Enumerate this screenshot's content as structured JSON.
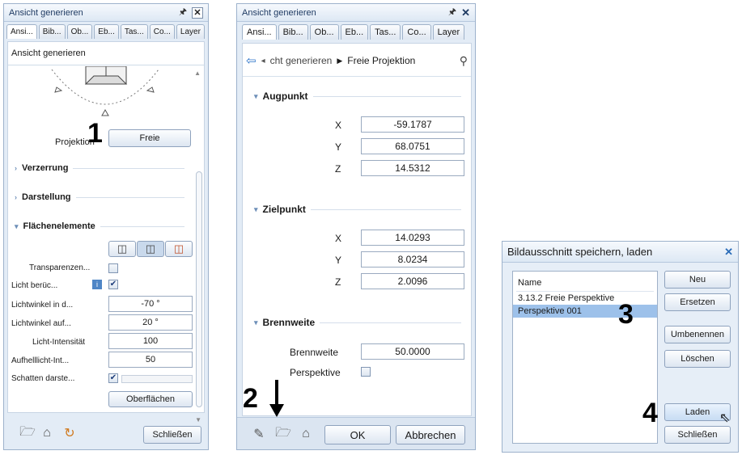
{
  "panel1": {
    "title": "Ansicht generieren",
    "tabs": [
      "Ansi...",
      "Bib...",
      "Ob...",
      "Eb...",
      "Tas...",
      "Co...",
      "Layer"
    ],
    "subtitle": "Ansicht generieren",
    "projektion_label": "Projektion",
    "projektion_value": "Freie",
    "sections": [
      "Verzerrung",
      "Darstellung",
      "Flächenelemente"
    ],
    "rows": [
      {
        "label": "Transparenzen...",
        "value": ""
      },
      {
        "label": "Licht berüc...",
        "value": ""
      },
      {
        "label": "Lichtwinkel in d...",
        "value": "-70 °"
      },
      {
        "label": "Lichtwinkel auf...",
        "value": "20 °"
      },
      {
        "label": "Licht-Intensität",
        "value": "100"
      },
      {
        "label": "Aufhelllicht-Int...",
        "value": "50"
      },
      {
        "label": "Schatten darste...",
        "value": ""
      }
    ],
    "oberflaechen": "Oberflächen",
    "close": "Schließen"
  },
  "panel2": {
    "title": "Ansicht generieren",
    "tabs": [
      "Ansi...",
      "Bib...",
      "Ob...",
      "Eb...",
      "Tas...",
      "Co...",
      "Layer"
    ],
    "breadcrumb_1": "cht generieren",
    "breadcrumb_2": "Freie Projektion",
    "augpunkt_header": "Augpunkt",
    "augpunkt": [
      {
        "axis": "X",
        "value": "-59.1787"
      },
      {
        "axis": "Y",
        "value": "68.0751"
      },
      {
        "axis": "Z",
        "value": "14.5312"
      }
    ],
    "zielpunkt_header": "Zielpunkt",
    "zielpunkt": [
      {
        "axis": "X",
        "value": "14.0293"
      },
      {
        "axis": "Y",
        "value": "8.0234"
      },
      {
        "axis": "Z",
        "value": "2.0096"
      }
    ],
    "brennweite_header": "Brennweite",
    "brennweite_label": "Brennweite",
    "brennweite_value": "50.0000",
    "perspektive_label": "Perspektive",
    "ok": "OK",
    "cancel": "Abbrechen"
  },
  "dialog": {
    "title": "Bildausschnitt speichern, laden",
    "column": "Name",
    "items": [
      "3.13.2 Freie Perspektive",
      "Perspektive 001"
    ],
    "selected_index": 1,
    "buttons": [
      "Neu",
      "Ersetzen",
      "Umbenennen",
      "Löschen",
      "Laden",
      "Schließen"
    ]
  },
  "markers": [
    "1",
    "2",
    "3",
    "4"
  ]
}
